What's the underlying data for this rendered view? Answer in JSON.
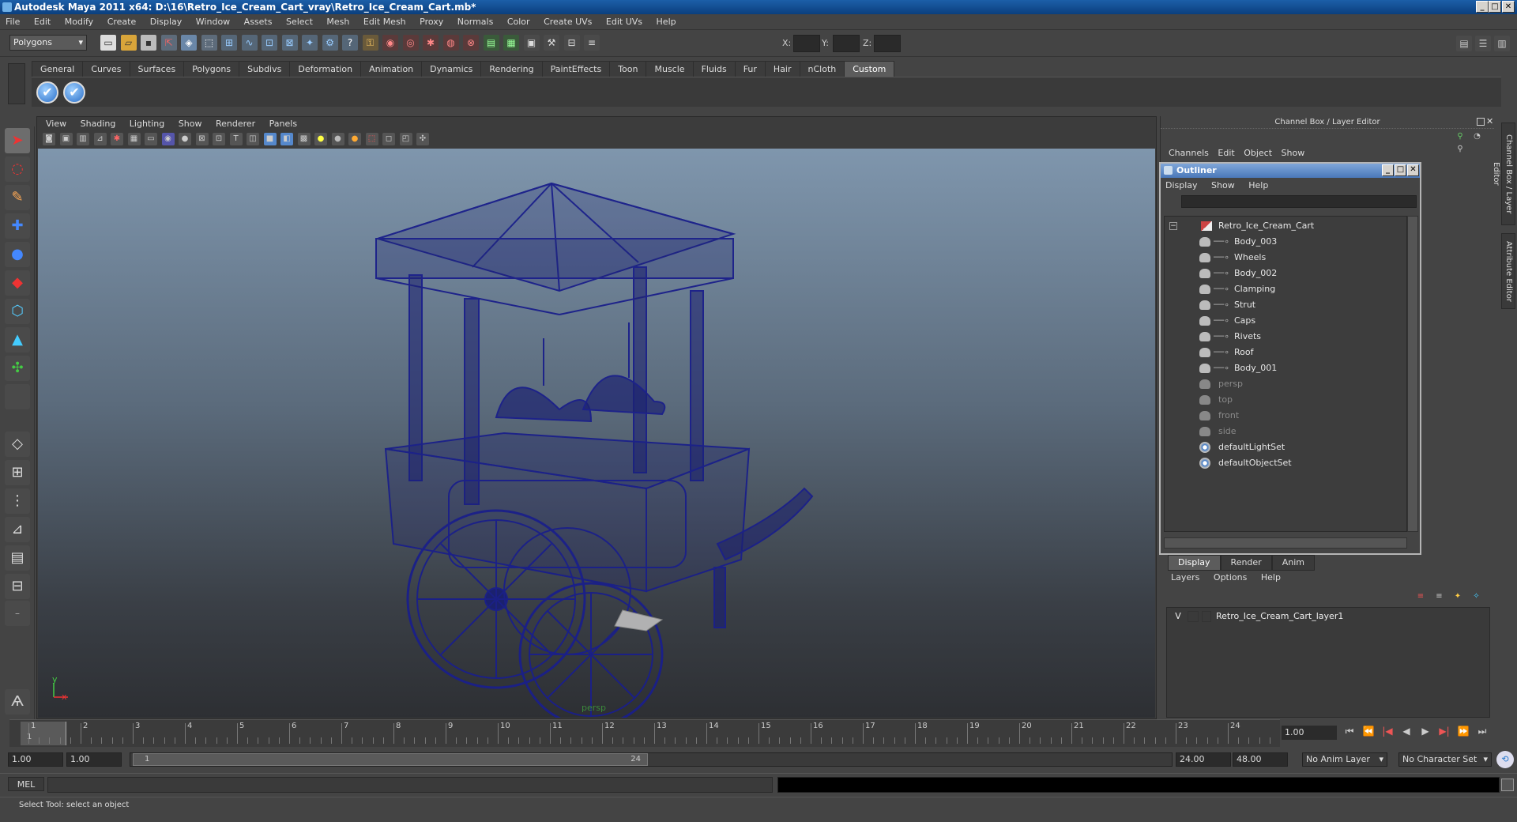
{
  "window": {
    "title": "Autodesk Maya 2011 x64: D:\\16\\Retro_Ice_Cream_Cart_vray\\Retro_Ice_Cream_Cart.mb*",
    "min": "_",
    "max": "□",
    "close": "✕"
  },
  "menubar": [
    "File",
    "Edit",
    "Modify",
    "Create",
    "Display",
    "Window",
    "Assets",
    "Select",
    "Mesh",
    "Edit Mesh",
    "Proxy",
    "Normals",
    "Color",
    "Create UVs",
    "Edit UVs",
    "Help"
  ],
  "statusline": {
    "mode": "Polygons",
    "x_label": "X:",
    "y_label": "Y:",
    "z_label": "Z:"
  },
  "shelf_tabs": [
    "General",
    "Curves",
    "Surfaces",
    "Polygons",
    "Subdivs",
    "Deformation",
    "Animation",
    "Dynamics",
    "Rendering",
    "PaintEffects",
    "Toon",
    "Muscle",
    "Fluids",
    "Fur",
    "Hair",
    "nCloth",
    "Custom"
  ],
  "shelf_buttons": [
    "✔",
    "✔"
  ],
  "viewport": {
    "menu": [
      "View",
      "Shading",
      "Lighting",
      "Show",
      "Renderer",
      "Panels"
    ],
    "camera": "persp",
    "axis_y": "y",
    "axis_x": "x"
  },
  "channelbox": {
    "title": "Channel Box / Layer Editor",
    "menu": [
      "Channels",
      "Edit",
      "Object",
      "Show"
    ]
  },
  "outliner": {
    "title": "Outliner",
    "menu": [
      "Display",
      "Show",
      "Help"
    ],
    "root": "Retro_Ice_Cream_Cart",
    "children": [
      "Body_003",
      "Wheels",
      "Body_002",
      "Clamping",
      "Strut",
      "Caps",
      "Rivets",
      "Roof",
      "Body_001"
    ],
    "cameras": [
      "persp",
      "top",
      "front",
      "side"
    ],
    "sets": [
      "defaultLightSet",
      "defaultObjectSet"
    ]
  },
  "layer_editor": {
    "tabs": [
      "Display",
      "Render",
      "Anim"
    ],
    "menu": [
      "Layers",
      "Options",
      "Help"
    ],
    "layer_visible": "V",
    "layer_name": "Retro_Ice_Cream_Cart_layer1"
  },
  "side_tabs": [
    "Channel Box / Layer Editor",
    "Attribute Editor"
  ],
  "timeline": {
    "frames": [
      "1",
      "2",
      "3",
      "4",
      "5",
      "6",
      "7",
      "8",
      "9",
      "10",
      "11",
      "12",
      "13",
      "14",
      "15",
      "16",
      "17",
      "18",
      "19",
      "20",
      "21",
      "22",
      "23",
      "24"
    ],
    "current_marker": "1",
    "current_frame": "1.00"
  },
  "playback": [
    "⏮",
    "⏪",
    "|◀",
    "◀",
    "▶",
    "▶|",
    "⏩",
    "⏭"
  ],
  "range": {
    "start": "1.00",
    "anim_start": "1.00",
    "handle_start": "1",
    "handle_end": "24",
    "end": "24.00",
    "anim_end": "48.00",
    "anim_layer": "No Anim Layer",
    "char_set": "No Character Set"
  },
  "command": {
    "label": "MEL"
  },
  "help": {
    "text": "Select Tool: select an object"
  }
}
